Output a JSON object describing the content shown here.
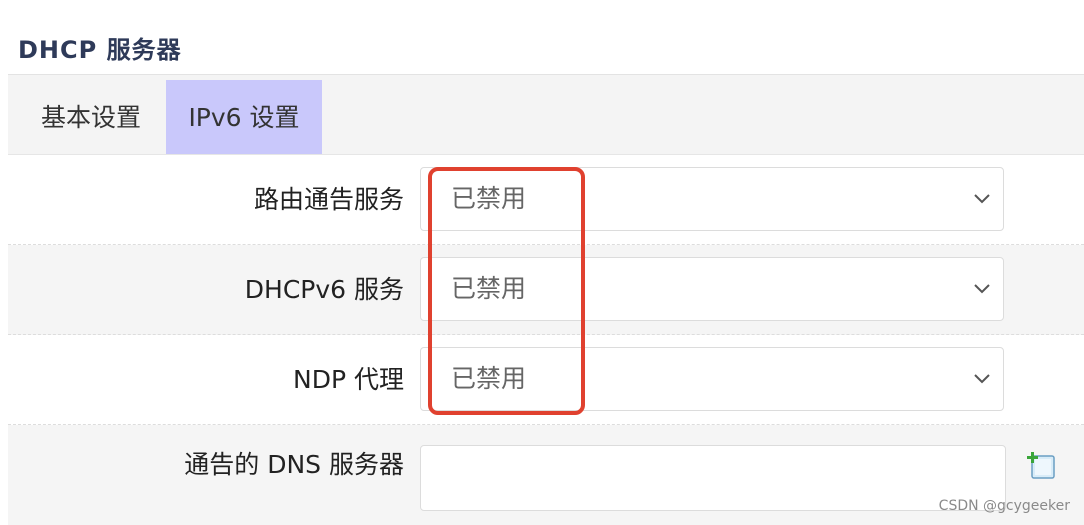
{
  "section": {
    "title": "DHCP 服务器"
  },
  "tabs": [
    {
      "label": "基本设置",
      "active": false
    },
    {
      "label": "IPv6 设置",
      "active": true
    }
  ],
  "form": {
    "rows": [
      {
        "label": "路由通告服务",
        "type": "select",
        "value": "已禁用"
      },
      {
        "label": "DHCPv6 服务",
        "type": "select",
        "value": "已禁用"
      },
      {
        "label": "NDP 代理",
        "type": "select",
        "value": "已禁用"
      },
      {
        "label": "通告的 DNS 服务器",
        "type": "text",
        "value": ""
      }
    ]
  },
  "icons": {
    "select_arrow": "chevron-down-icon",
    "add_entry": "add-entry-icon"
  },
  "colors": {
    "active_tab": "#c9c8fb",
    "highlight": "#e0412f",
    "title": "#2e3a59"
  },
  "watermark": "CSDN @gcygeeker"
}
